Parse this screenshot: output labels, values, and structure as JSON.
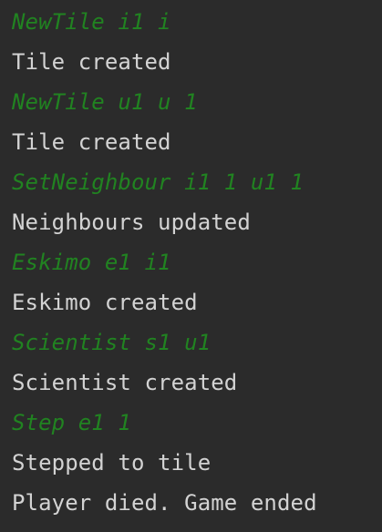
{
  "console": {
    "lines": [
      {
        "kind": "input",
        "text": "NewTile i1 i"
      },
      {
        "kind": "output",
        "text": "Tile created"
      },
      {
        "kind": "input",
        "text": "NewTile u1 u 1"
      },
      {
        "kind": "output",
        "text": "Tile created"
      },
      {
        "kind": "input",
        "text": "SetNeighbour i1 1 u1 1"
      },
      {
        "kind": "output",
        "text": "Neighbours updated"
      },
      {
        "kind": "input",
        "text": "Eskimo e1 i1"
      },
      {
        "kind": "output",
        "text": "Eskimo created"
      },
      {
        "kind": "input",
        "text": "Scientist s1 u1"
      },
      {
        "kind": "output",
        "text": "Scientist created"
      },
      {
        "kind": "input",
        "text": "Step e1 1"
      },
      {
        "kind": "output",
        "text": "Stepped to tile"
      },
      {
        "kind": "output",
        "text": "Player died. Game ended"
      }
    ],
    "colors": {
      "background": "#2b2b2b",
      "input_text": "#218321",
      "output_text": "#d3d3d3"
    }
  }
}
